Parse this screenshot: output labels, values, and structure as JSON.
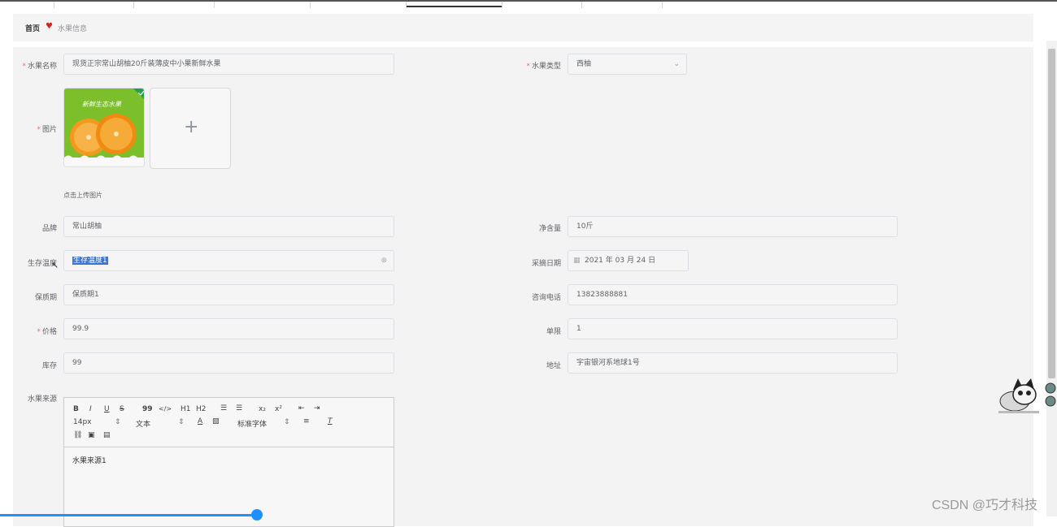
{
  "breadcrumb": {
    "home": "首页",
    "current": "水果信息"
  },
  "form": {
    "fruit_name": {
      "label": "水果名称",
      "value": "现货正宗常山胡柚20斤装薄皮中小果新鲜水果"
    },
    "fruit_type": {
      "label": "水果类型",
      "value": "西柚"
    },
    "image": {
      "label": "图片",
      "hint": "点击上传图片",
      "thumb_text": "新鲜生态水果"
    },
    "brand": {
      "label": "品牌",
      "value": "常山胡柚"
    },
    "net_weight": {
      "label": "净含量",
      "value": "10斤"
    },
    "storage_temp": {
      "label": "生存温度",
      "value": "生存温度1"
    },
    "pick_date": {
      "label": "采摘日期",
      "value": "2021 年 03 月 24 日"
    },
    "shelf_life": {
      "label": "保质期",
      "value": "保质期1"
    },
    "phone": {
      "label": "咨询电话",
      "value": "13823888881"
    },
    "price": {
      "label": "价格",
      "value": "99.9"
    },
    "limit": {
      "label": "单限",
      "value": "1"
    },
    "stock": {
      "label": "库存",
      "value": "99"
    },
    "address": {
      "label": "地址",
      "value": "宇宙银河系地球1号"
    },
    "source": {
      "label": "水果来源",
      "content": "水果来源1"
    }
  },
  "editor_toolbar": {
    "bold": "B",
    "italic": "I",
    "underline": "U",
    "strike": "S",
    "quote": "99",
    "code": "</>",
    "h1": "H1",
    "h2": "H2",
    "sub": "x₂",
    "sup": "x²",
    "size": "14px",
    "text": "文本",
    "font": "标准字体"
  },
  "watermark": "CSDN @巧才科技",
  "colors": {
    "required": "#f56c6c",
    "heart": "#e41c1c",
    "selection": "#3b75d1",
    "scroll": "#1e90ff"
  }
}
